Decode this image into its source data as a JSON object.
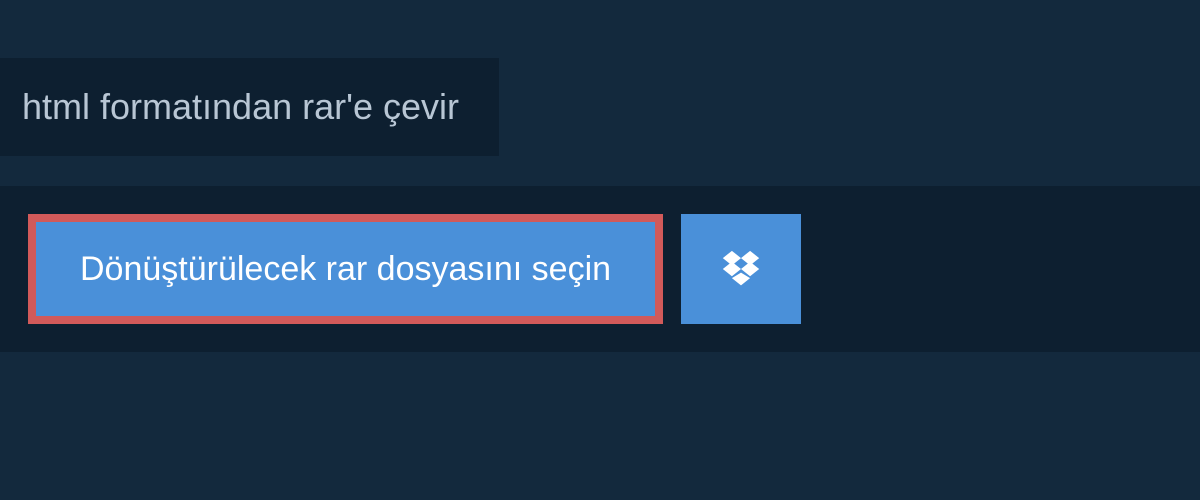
{
  "header": {
    "title": "html formatından rar'e çevir"
  },
  "upload": {
    "select_label": "Dönüştürülecek rar dosyasını seçin",
    "dropbox_icon": "dropbox"
  },
  "colors": {
    "bg_dark": "#13293d",
    "bg_darker": "#0d1f30",
    "button_blue": "#4a90d9",
    "highlight_border": "#d15a5a",
    "text_light": "#b8c6d4",
    "text_white": "#ffffff"
  }
}
